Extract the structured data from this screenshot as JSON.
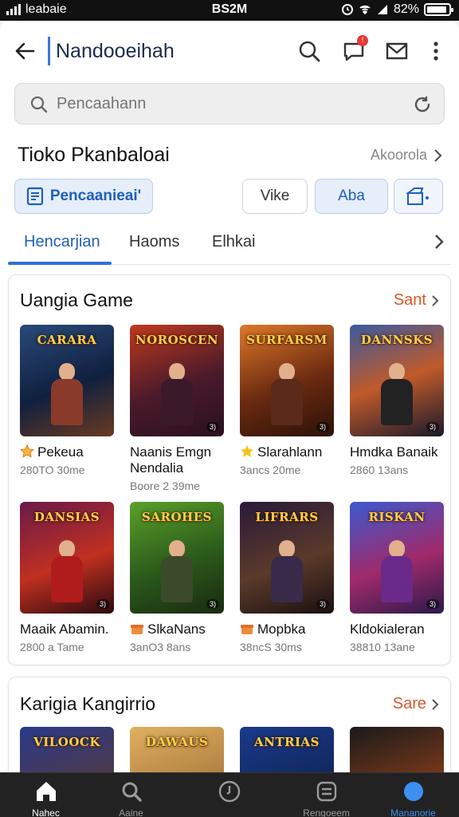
{
  "status": {
    "carrier": "leabaie",
    "time": "BS2M",
    "battery": "82%"
  },
  "header": {
    "title": "Nandooeihah",
    "notification_count": "!"
  },
  "search": {
    "placeholder": "Pencaahann"
  },
  "store": {
    "title": "Tioko Pkanbaloai",
    "link": "Akoorola"
  },
  "chips": {
    "primary": "Pencaanieai'",
    "white": "Vike",
    "blue": "Aba"
  },
  "tabs": [
    "Hencarjian",
    "Haoms",
    "Elhkai"
  ],
  "section1": {
    "title": "Uangia Game",
    "more": "Sant",
    "games": [
      {
        "logo": "CARARA",
        "name": "Pekeua",
        "meta": "280TO 30me",
        "icon": "star-badge-icon"
      },
      {
        "logo": "NOROSCEN",
        "name": "Naanis Emgn Nendalia",
        "meta": "Boore 2 39me",
        "icon": ""
      },
      {
        "logo": "SURFARSM",
        "name": "Slarahlann",
        "meta": "3ancs 20me",
        "icon": "star-icon"
      },
      {
        "logo": "DANNSKS",
        "name": "Hmdka Banaik",
        "meta": "2860 13ans",
        "icon": ""
      },
      {
        "logo": "DANSIAS",
        "name": "Maaik Abamin.",
        "meta": "2800 a Tame",
        "icon": ""
      },
      {
        "logo": "SAROHES",
        "name": "SlkaNans",
        "meta": "3anO3 8ans",
        "icon": "gift-icon"
      },
      {
        "logo": "LIFRARS",
        "name": "Mopbka",
        "meta": "38ncS 30ms",
        "icon": "gift-icon"
      },
      {
        "logo": "RISKAN",
        "name": "Kldokialeran",
        "meta": "38810 13ane",
        "icon": ""
      }
    ]
  },
  "section2": {
    "title": "Karigia Kangirrio",
    "more": "Sare",
    "games": [
      {
        "logo": "VILOOCK"
      },
      {
        "logo": "DAWAUS"
      },
      {
        "logo": "ANTRIAS"
      },
      {
        "logo": ""
      }
    ]
  },
  "nav": [
    {
      "label": "Nahec",
      "icon": "home-icon"
    },
    {
      "label": "Aaine",
      "icon": "search-icon"
    },
    {
      "label": "",
      "icon": "clock-icon"
    },
    {
      "label": "Rengoeem",
      "icon": "list-icon"
    },
    {
      "label": "Mananorie",
      "icon": "profile-icon"
    }
  ],
  "colors": {
    "accent": "#2f72d6",
    "more_link": "#d9582b",
    "nav_bg": "#222222"
  }
}
